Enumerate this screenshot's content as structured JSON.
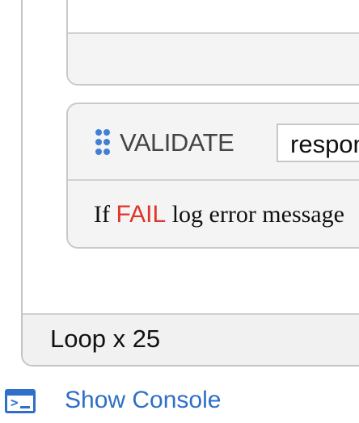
{
  "validate_block": {
    "keyword": "VALIDATE",
    "input_value": "respon",
    "message_prefix": "If ",
    "fail_word": "FAIL",
    "message_suffix": " log error message",
    "fail_color": "#e0352b"
  },
  "loop": {
    "label": "Loop x 25"
  },
  "console": {
    "icon": "terminal-icon",
    "link_label": "Show Console",
    "link_color": "#2f6fc7"
  },
  "colors": {
    "drag_handle": "#3f7fd6",
    "border": "#c9c9c9",
    "panel_bg": "#f4f4f4"
  }
}
